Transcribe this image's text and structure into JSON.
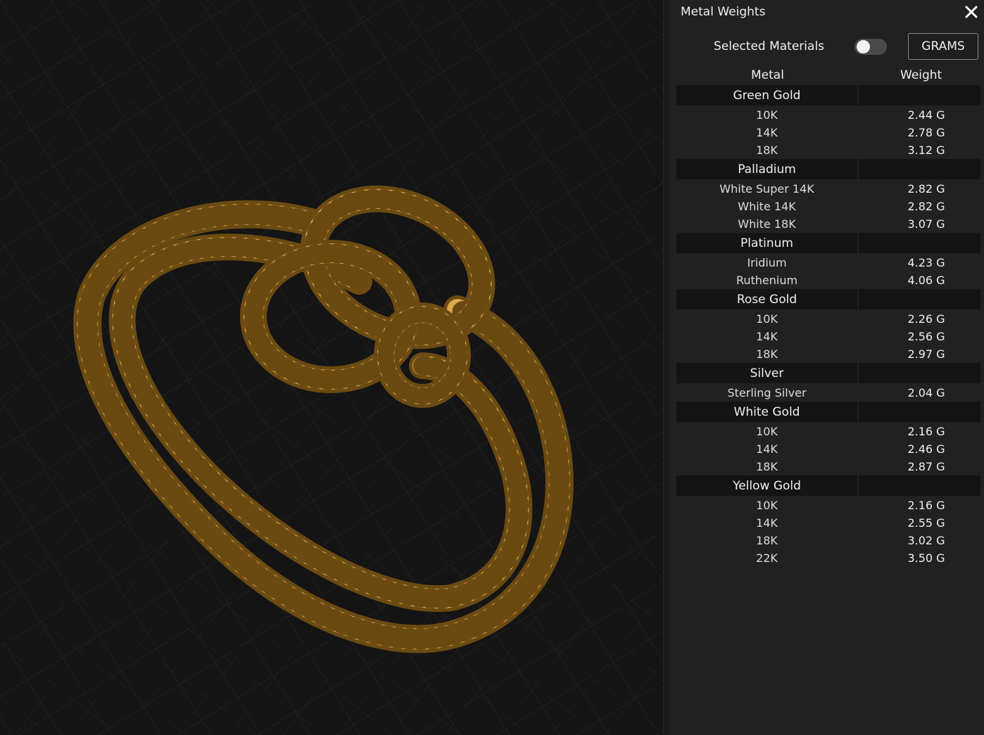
{
  "panel": {
    "title": "Metal Weights",
    "selected_materials_label": "Selected Materials",
    "selected_materials_on": false,
    "units_button": "GRAMS",
    "columns": {
      "metal": "Metal",
      "weight": "Weight"
    }
  },
  "groups": [
    {
      "name": "Green Gold",
      "items": [
        {
          "metal": "10K",
          "weight": "2.44 G"
        },
        {
          "metal": "14K",
          "weight": "2.78 G"
        },
        {
          "metal": "18K",
          "weight": "3.12 G"
        }
      ]
    },
    {
      "name": "Palladium",
      "items": [
        {
          "metal": "White Super 14K",
          "weight": "2.82 G"
        },
        {
          "metal": "White 14K",
          "weight": "2.82 G"
        },
        {
          "metal": "White 18K",
          "weight": "3.07 G"
        }
      ]
    },
    {
      "name": "Platinum",
      "items": [
        {
          "metal": "Iridium",
          "weight": "4.23 G"
        },
        {
          "metal": "Ruthenium",
          "weight": "4.06 G"
        }
      ]
    },
    {
      "name": "Rose Gold",
      "items": [
        {
          "metal": "10K",
          "weight": "2.26 G"
        },
        {
          "metal": "14K",
          "weight": "2.56 G"
        },
        {
          "metal": "18K",
          "weight": "2.97 G"
        }
      ]
    },
    {
      "name": "Silver",
      "items": [
        {
          "metal": "Sterling Silver",
          "weight": "2.04 G"
        }
      ]
    },
    {
      "name": "White Gold",
      "items": [
        {
          "metal": "10K",
          "weight": "2.16 G"
        },
        {
          "metal": "14K",
          "weight": "2.46 G"
        },
        {
          "metal": "18K",
          "weight": "2.87 G"
        }
      ]
    },
    {
      "name": "Yellow Gold",
      "items": [
        {
          "metal": "10K",
          "weight": "2.16 G"
        },
        {
          "metal": "14K",
          "weight": "2.55 G"
        },
        {
          "metal": "18K",
          "weight": "3.02 G"
        },
        {
          "metal": "22K",
          "weight": "3.50 G"
        }
      ]
    }
  ],
  "colors": {
    "gold": "#d9a84a",
    "background": "#141414",
    "panel": "#212121"
  }
}
